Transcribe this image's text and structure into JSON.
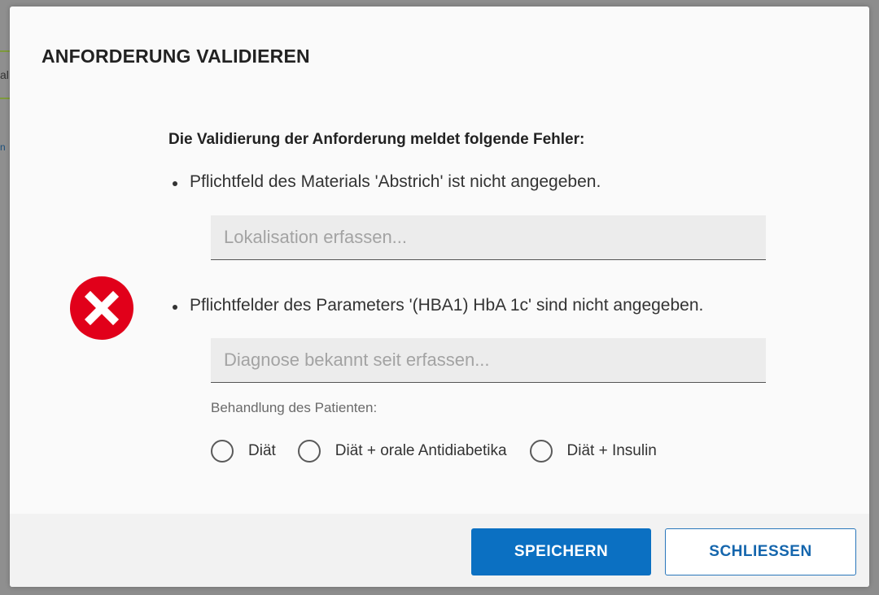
{
  "background": {
    "fragment_text_1": "al",
    "fragment_text_2": "n"
  },
  "dialog": {
    "title": "ANFORDERUNG VALIDIEREN",
    "icon": "error-x-icon",
    "icon_color": "#e1001a",
    "heading": "Die Validierung der Anforderung meldet folgende Fehler:",
    "errors": [
      {
        "message": "Pflichtfeld des Materials 'Abstrich' ist nicht angegeben.",
        "input": {
          "value": "",
          "placeholder": "Lokalisation erfassen..."
        }
      },
      {
        "message": "Pflichtfelder des Parameters '(HBA1) HbA 1c' sind nicht angegeben.",
        "input": {
          "value": "",
          "placeholder": "Diagnose bekannt seit erfassen..."
        },
        "radio_group": {
          "label": "Behandlung des Patienten:",
          "options": [
            {
              "label": "Diät",
              "selected": false
            },
            {
              "label": "Diät + orale Antidiabetika",
              "selected": false
            },
            {
              "label": "Diät + Insulin",
              "selected": false
            }
          ]
        }
      }
    ],
    "buttons": {
      "save_label": "SPEICHERN",
      "close_label": "SCHLIESSEN"
    },
    "colors": {
      "primary": "#0b70c2",
      "error": "#e1001a"
    }
  }
}
